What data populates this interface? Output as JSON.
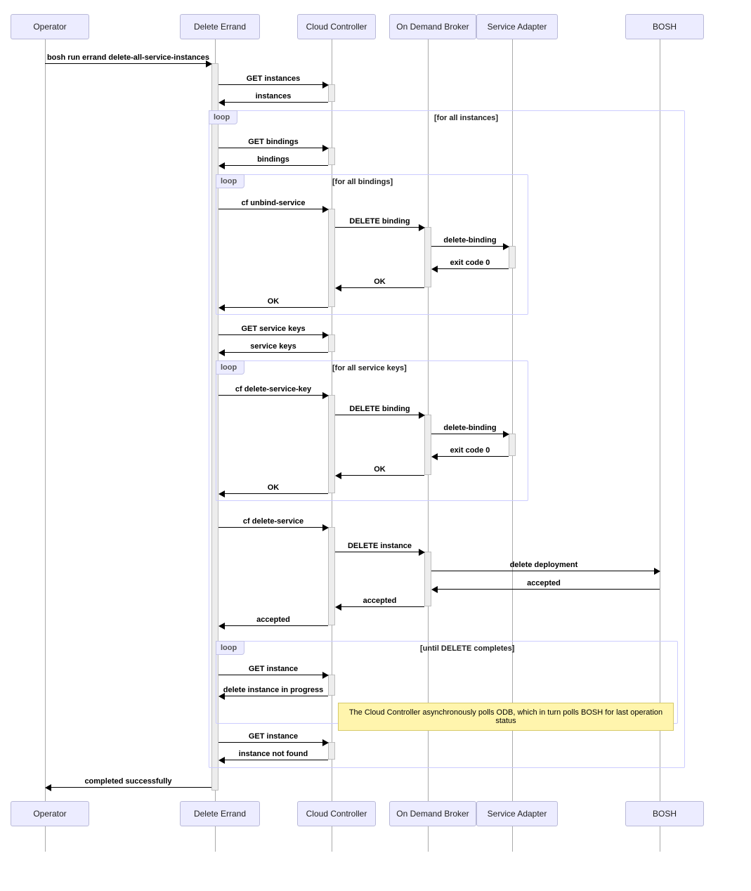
{
  "actors": {
    "operator": "Operator",
    "errand": "Delete Errand",
    "cc": "Cloud Controller",
    "odb": "On Demand Broker",
    "sa": "Service Adapter",
    "bosh": "BOSH"
  },
  "loops": {
    "word": "loop",
    "instances": "[for all instances]",
    "bindings": "[for all bindings]",
    "keys": "[for all service keys]",
    "delete": "[until DELETE completes]"
  },
  "msgs": {
    "run_errand": "bosh run errand delete-all-service-instances",
    "get_instances": "GET instances",
    "instances": "instances",
    "get_bindings": "GET bindings",
    "bindings": "bindings",
    "cf_unbind": "cf unbind-service",
    "del_binding": "DELETE binding",
    "delete_binding": "delete-binding",
    "exit0": "exit code 0",
    "ok": "OK",
    "get_keys": "GET service keys",
    "keys": "service keys",
    "cf_delkey": "cf delete-service-key",
    "cf_delsvc": "cf delete-service",
    "del_instance": "DELETE instance",
    "del_deploy": "delete deployment",
    "accepted": "accepted",
    "get_instance": "GET instance",
    "del_prog": "delete instance in progress",
    "get_instance2": "GET instance",
    "not_found": "instance not found",
    "completed": "completed successfully"
  },
  "note": "The Cloud Controller asynchronously polls ODB, which in turn polls BOSH for last operation status"
}
